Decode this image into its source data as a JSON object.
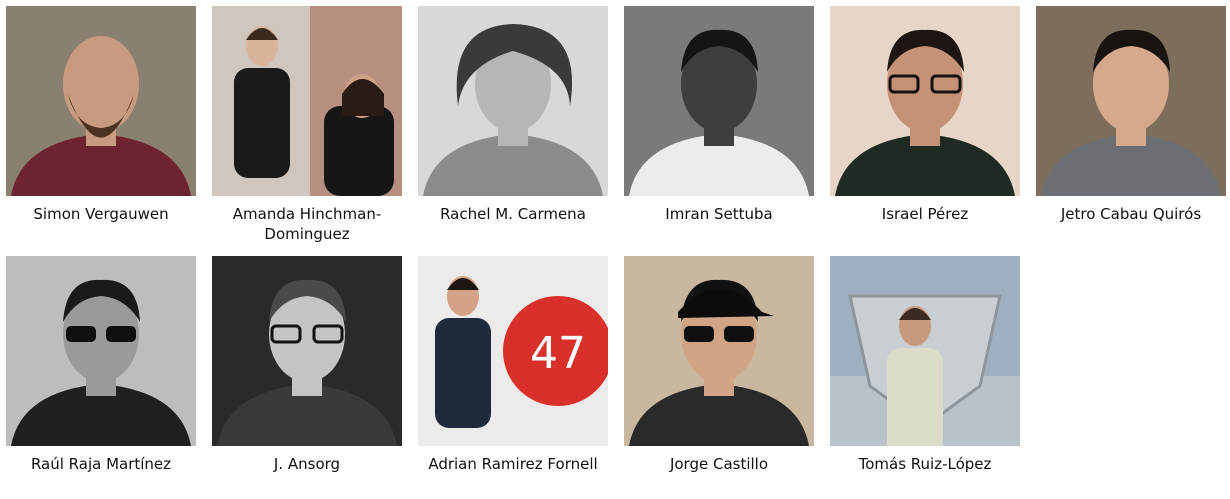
{
  "speakers": [
    {
      "name": "Simon Vergauwen",
      "photo": "photo-bearded-man-maroon-sweater",
      "bg": "#8a8070",
      "tone": "#c89a80",
      "shirt": "#6d2330",
      "hair": "#3a2a20"
    },
    {
      "name": "Amanda Hinchman-Dominguez",
      "photo": "photo-two-people-with-mic",
      "bg": "#cfc6bd",
      "tone": "#d9b49a",
      "shirt": "#1a1a1a",
      "hair": "#3b2a1e"
    },
    {
      "name": "Rachel M. Carmena",
      "photo": "photo-woman-curly-hair-bw",
      "bg": "#d8d8d8",
      "tone": "#b6b6b6",
      "shirt": "#8c8c8c",
      "hair": "#3a3a3a"
    },
    {
      "name": "Imran Settuba",
      "photo": "photo-man-white-shirt-bw",
      "bg": "#7a7a7a",
      "tone": "#3e3e3e",
      "shirt": "#ececec",
      "hair": "#151515"
    },
    {
      "name": "Israel Pérez",
      "photo": "photo-man-glasses-scarf",
      "bg": "#e7d6c8",
      "tone": "#c69277",
      "shirt": "#1f2a22",
      "hair": "#1e1612"
    },
    {
      "name": "Jetro Cabau Quirós",
      "photo": "photo-smiling-man-grey-shirt",
      "bg": "#7d6e5c",
      "tone": "#d6a88c",
      "shirt": "#6b6f73",
      "hair": "#1a1410"
    },
    {
      "name": "Raúl Raja Martínez",
      "photo": "photo-man-sunglasses-bw",
      "bg": "#bdbdbd",
      "tone": "#9a9a9a",
      "shirt": "#202020",
      "hair": "#1a1a1a"
    },
    {
      "name": "J. Ansorg",
      "photo": "photo-man-glasses-bw",
      "bg": "#2a2a2a",
      "tone": "#c4c4c4",
      "shirt": "#3a3a3a",
      "hair": "#4a4a4a"
    },
    {
      "name": "Adrian Ramirez Fornell",
      "photo": "photo-man-cardigan-red-47-logo",
      "bg": "#ecebea",
      "tone": "#d4a287",
      "shirt": "#1f2a3d",
      "hair": "#1d1612"
    },
    {
      "name": "Jorge Castillo",
      "photo": "photo-man-cap-sunglasses",
      "bg": "#c9b79f",
      "tone": "#d1a486",
      "shirt": "#2a2a2a",
      "hair": "#111111"
    },
    {
      "name": "Tomás Ruiz-López",
      "photo": "photo-man-superman-statue",
      "bg": "#9fb0c2",
      "tone": "#c89a7d",
      "shirt": "#dcdcc8",
      "hair": "#3a2a20"
    }
  ],
  "accent": "#d9302b"
}
